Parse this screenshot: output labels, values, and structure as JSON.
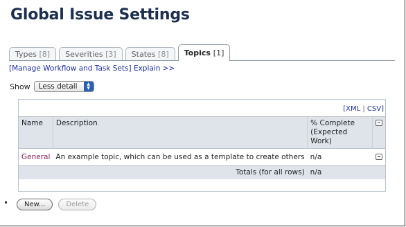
{
  "page": {
    "title": "Global Issue Settings"
  },
  "tabs": [
    {
      "name": "Types",
      "count": "[8]",
      "active": false
    },
    {
      "name": "Severities",
      "count": "[3]",
      "active": false
    },
    {
      "name": "States",
      "count": "[8]",
      "active": false
    },
    {
      "name": "Topics",
      "count": "[1]",
      "active": true
    }
  ],
  "links": {
    "manage_workflow": "[Manage Workflow and Task Sets]",
    "explain": "Explain >>"
  },
  "show": {
    "label": "Show",
    "selected": "Less detail"
  },
  "export": {
    "xml": "[XML",
    "sep": "|",
    "csv": "CSV]"
  },
  "table": {
    "headers": {
      "name": "Name",
      "description": "Description",
      "pct_line1": "% Complete",
      "pct_line2": "(Expected",
      "pct_line3": "Work)"
    },
    "rows": [
      {
        "name": "General",
        "description": "An example topic, which can be used as a template to create others",
        "pct": "n/a"
      }
    ],
    "totals_label": "Totals (for all rows)",
    "totals_value": "n/a"
  },
  "buttons": {
    "new": "New...",
    "delete": "Delete"
  },
  "colors": {
    "title": "#1c2f4e",
    "link": "#1a2fa0",
    "topic_link": "#8a1f5a",
    "header_bg": "#dfe4ea"
  }
}
